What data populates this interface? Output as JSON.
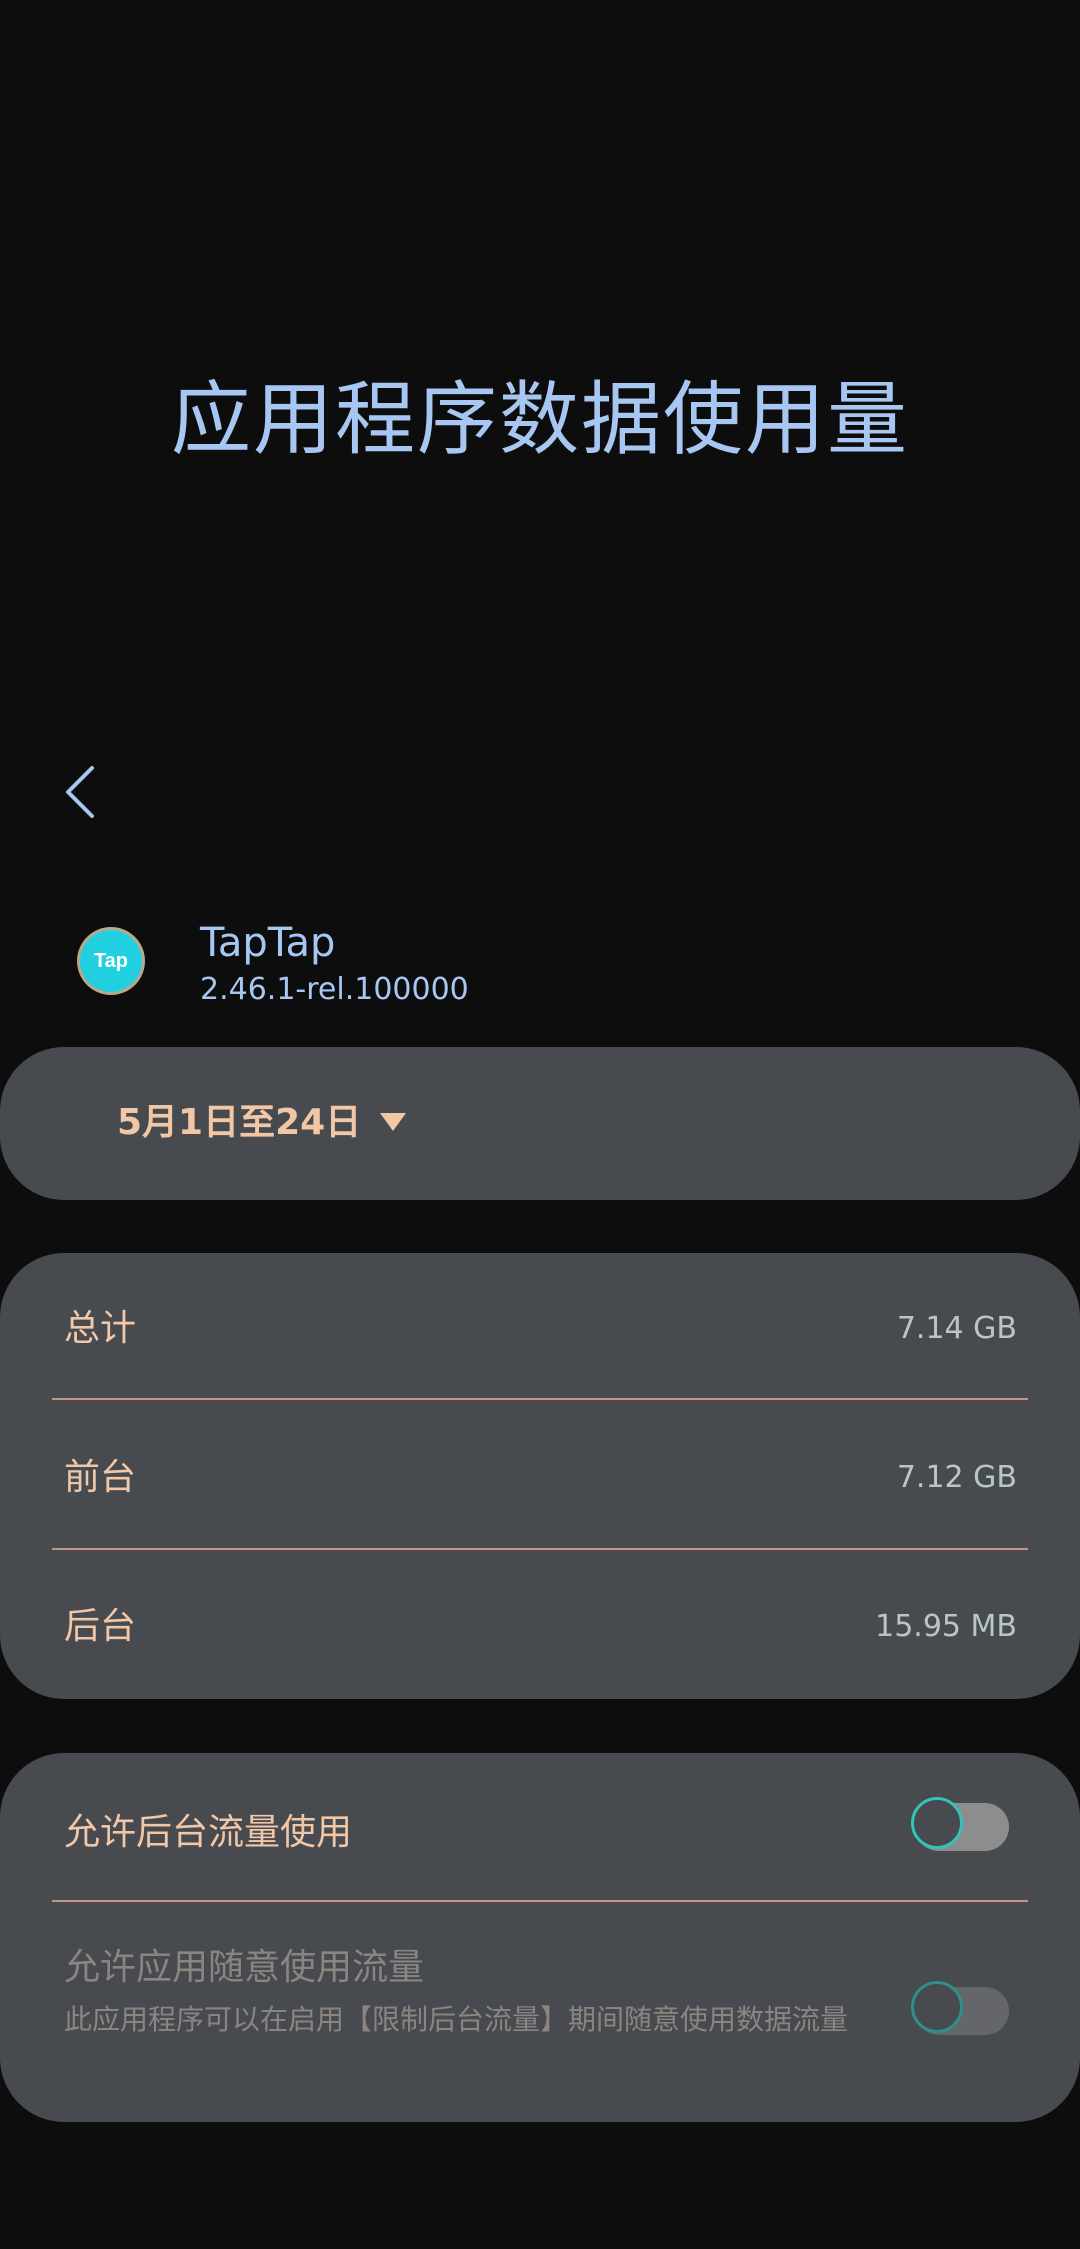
{
  "header": {
    "title": "应用程序数据使用量"
  },
  "app": {
    "name": "TapTap",
    "version": "2.46.1-rel.100000",
    "icon_text": "Tap"
  },
  "date_range": {
    "label": "5月1日至24日"
  },
  "usage": {
    "rows": [
      {
        "label": "总计",
        "value": "7.14 GB"
      },
      {
        "label": "前台",
        "value": "7.12 GB"
      },
      {
        "label": "后台",
        "value": "15.95 MB"
      }
    ]
  },
  "settings": {
    "background_data": {
      "title": "允许后台流量使用",
      "enabled": false
    },
    "unrestricted_data": {
      "title": "允许应用随意使用流量",
      "description": "此应用程序可以在启用【限制后台流量】期间随意使用数据流量",
      "enabled": false
    }
  },
  "colors": {
    "background": "#0d0d0d",
    "card": "#474a4f",
    "title": "#a7c7f2",
    "accent_text": "#f2c7a6",
    "divider": "#c9917f",
    "toggle_ring": "#32c4b8"
  }
}
